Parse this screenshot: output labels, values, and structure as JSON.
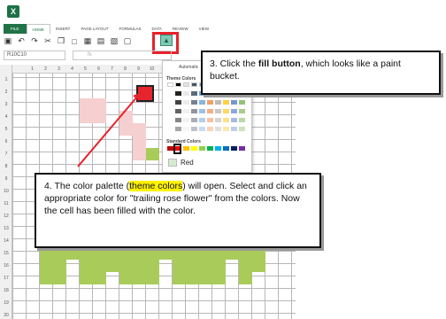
{
  "app": {
    "logo_text": "X"
  },
  "ribbon": {
    "tabs": [
      {
        "label": "FILE"
      },
      {
        "label": "HOME"
      },
      {
        "label": "INSERT"
      },
      {
        "label": "PAGE LAYOUT"
      },
      {
        "label": "FORMULAS"
      },
      {
        "label": "DATA"
      },
      {
        "label": "REVIEW"
      },
      {
        "label": "VIEW"
      }
    ],
    "active_tab": "HOME"
  },
  "formula_bar": {
    "name_box": "R10C10",
    "fx_label": "fx"
  },
  "columns": [
    "1",
    "2",
    "3",
    "4",
    "5",
    "6",
    "7",
    "8",
    "9",
    "10"
  ],
  "rows": [
    "1",
    "2",
    "3",
    "4",
    "5",
    "6",
    "7",
    "8",
    "9",
    "10",
    "11",
    "12",
    "13",
    "14",
    "15",
    "16",
    "17",
    "18",
    "19",
    "20"
  ],
  "palette": {
    "automatic_label": "Automatic",
    "theme_label": "Theme Colors",
    "standard_label": "Standard Colors",
    "hover_label": "Red",
    "standard_colors": [
      "#c00000",
      "#ff0000",
      "#ffc000",
      "#ffff00",
      "#92d050",
      "#00b050",
      "#00b0f0",
      "#0070c0",
      "#002060",
      "#7030a0"
    ],
    "theme_colors": [
      "#ffffff",
      "#000000",
      "#e7e6e6",
      "#44546a",
      "#5b9bd5",
      "#ed7d31",
      "#a5a5a5",
      "#ffc000",
      "#4472c4",
      "#70ad47"
    ]
  },
  "callouts": {
    "step3_prefix": "3. Click the ",
    "step3_bold": "fill button",
    "step3_suffix": ", which looks like a paint bucket.",
    "step4_prefix": "4. The color palette (",
    "step4_highlight": "theme colors",
    "step4_suffix": ") will open. Select and click an appropriate color for \"trailing rose flower\" from the colors. Now the cell has been filled with the color."
  },
  "colors": {
    "highlight_red": "#e8212b",
    "flower_pink": "#f6cfd1",
    "leaf_green": "#a9cb5a",
    "excel_green": "#217346"
  }
}
